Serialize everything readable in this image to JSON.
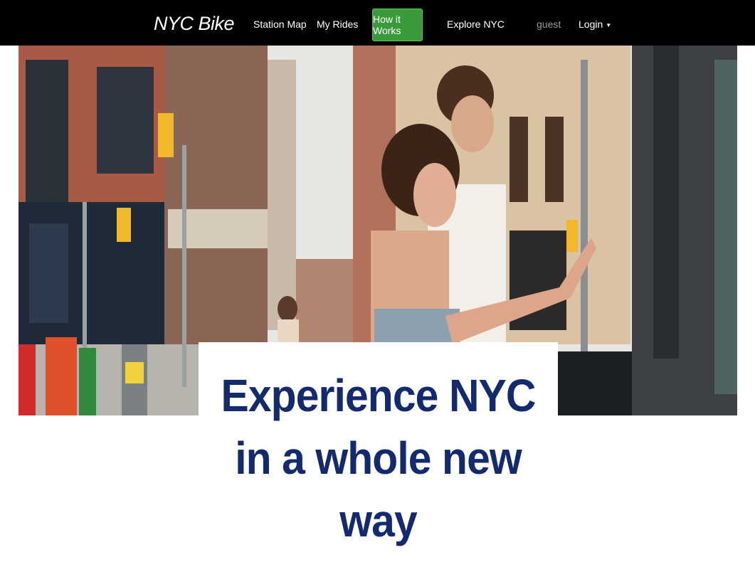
{
  "nav": {
    "brand": "NYC Bike",
    "items": [
      {
        "label": "Station Map"
      },
      {
        "label": "My Rides"
      },
      {
        "label": "How it Works",
        "active": true
      },
      {
        "label": "Explore NYC"
      }
    ],
    "user": "guest",
    "login_label": "Login",
    "active_color": "#3a9b3a"
  },
  "hero": {
    "image": "couple-at-bike-station-street-photo",
    "headline_lines": [
      "Experience NYC",
      "in a whole new",
      "way"
    ],
    "headline_color": "#142a6e"
  }
}
